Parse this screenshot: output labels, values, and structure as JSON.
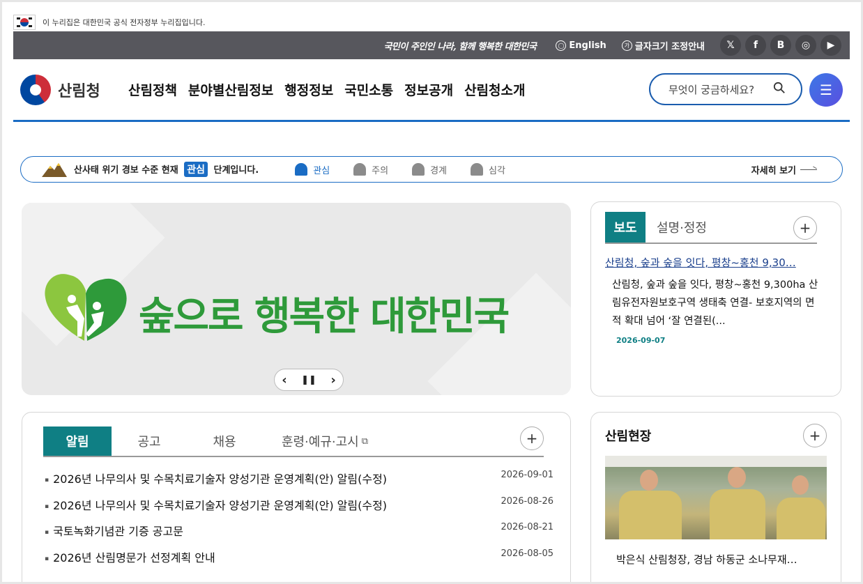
{
  "gov_banner": {
    "text": "이 누리집은 대한민국 공식 전자정부 누리집입니다."
  },
  "util": {
    "slogan": "국민이 주인인 나라, 함께 행복한 대한민국",
    "english_label": "English",
    "fontsize_label": "글자크기 조정안내",
    "fontsize_icon_glyph": "가",
    "sns": [
      {
        "name": "x-icon",
        "glyph": "𝕏"
      },
      {
        "name": "facebook-icon",
        "glyph": "f"
      },
      {
        "name": "blog-icon",
        "glyph": "B"
      },
      {
        "name": "instagram-icon",
        "glyph": "◎"
      },
      {
        "name": "youtube-icon",
        "glyph": "▶"
      }
    ]
  },
  "header": {
    "logo_text": "산림청",
    "nav": [
      "산림정책",
      "분야별산림정보",
      "행정정보",
      "국민소통",
      "정보공개",
      "산림청소개"
    ],
    "search_placeholder": "무엇이 궁금하세요?",
    "menu_glyph": "☰"
  },
  "alert": {
    "text_before": "산사태 위기 경보 수준 현재",
    "current_level": "관심",
    "text_after": "단계입니다.",
    "levels": [
      "관심",
      "주의",
      "경계",
      "심각"
    ],
    "active_level_index": 0,
    "more_label": "자세히 보기"
  },
  "hero": {
    "text": "숲으로 행복한 대한민국",
    "prev_glyph": "‹",
    "pause_glyph": "❚❚",
    "next_glyph": "›",
    "accent_color": "#2e9a3a"
  },
  "press": {
    "tabs": [
      "보도",
      "설명·정정"
    ],
    "more_glyph": "+",
    "headline": "산림청, 숲과 숲을 잇다, 평창~홍천 9,30…",
    "body": "산림청, 숲과 숲을 잇다, 평창~홍천 9,300ha 산림유전자원보호구역 생태축 연결- 보호지역의 면적 확대 넘어 ‘잘 연결된(...",
    "date": "2026-09-07"
  },
  "notice": {
    "tabs": [
      "알림",
      "공고",
      "채용",
      "훈령·예규·고시"
    ],
    "external_glyph": "⧉",
    "more_glyph": "+",
    "items": [
      {
        "title": "2026년 나무의사 및 수목치료기술자 양성기관 운영계획(안) 알림(수정)",
        "date": "2026-09-01"
      },
      {
        "title": "2026년 나무의사 및 수목치료기술자 양성기관 운영계획(안) 알림(수정)",
        "date": "2026-08-26"
      },
      {
        "title": "국토녹화기념관 기증 공고문",
        "date": "2026-08-21"
      },
      {
        "title": "2026년 산림명문가 선정계획 안내",
        "date": "2026-08-05"
      }
    ]
  },
  "site": {
    "title": "산림현장",
    "more_glyph": "+",
    "caption": "박은식 산림청장, 경남 하동군 소나무재…"
  },
  "colors": {
    "primary_blue": "#1a6cc4",
    "teal": "#0f7f84",
    "util_bar": "#57575d"
  }
}
